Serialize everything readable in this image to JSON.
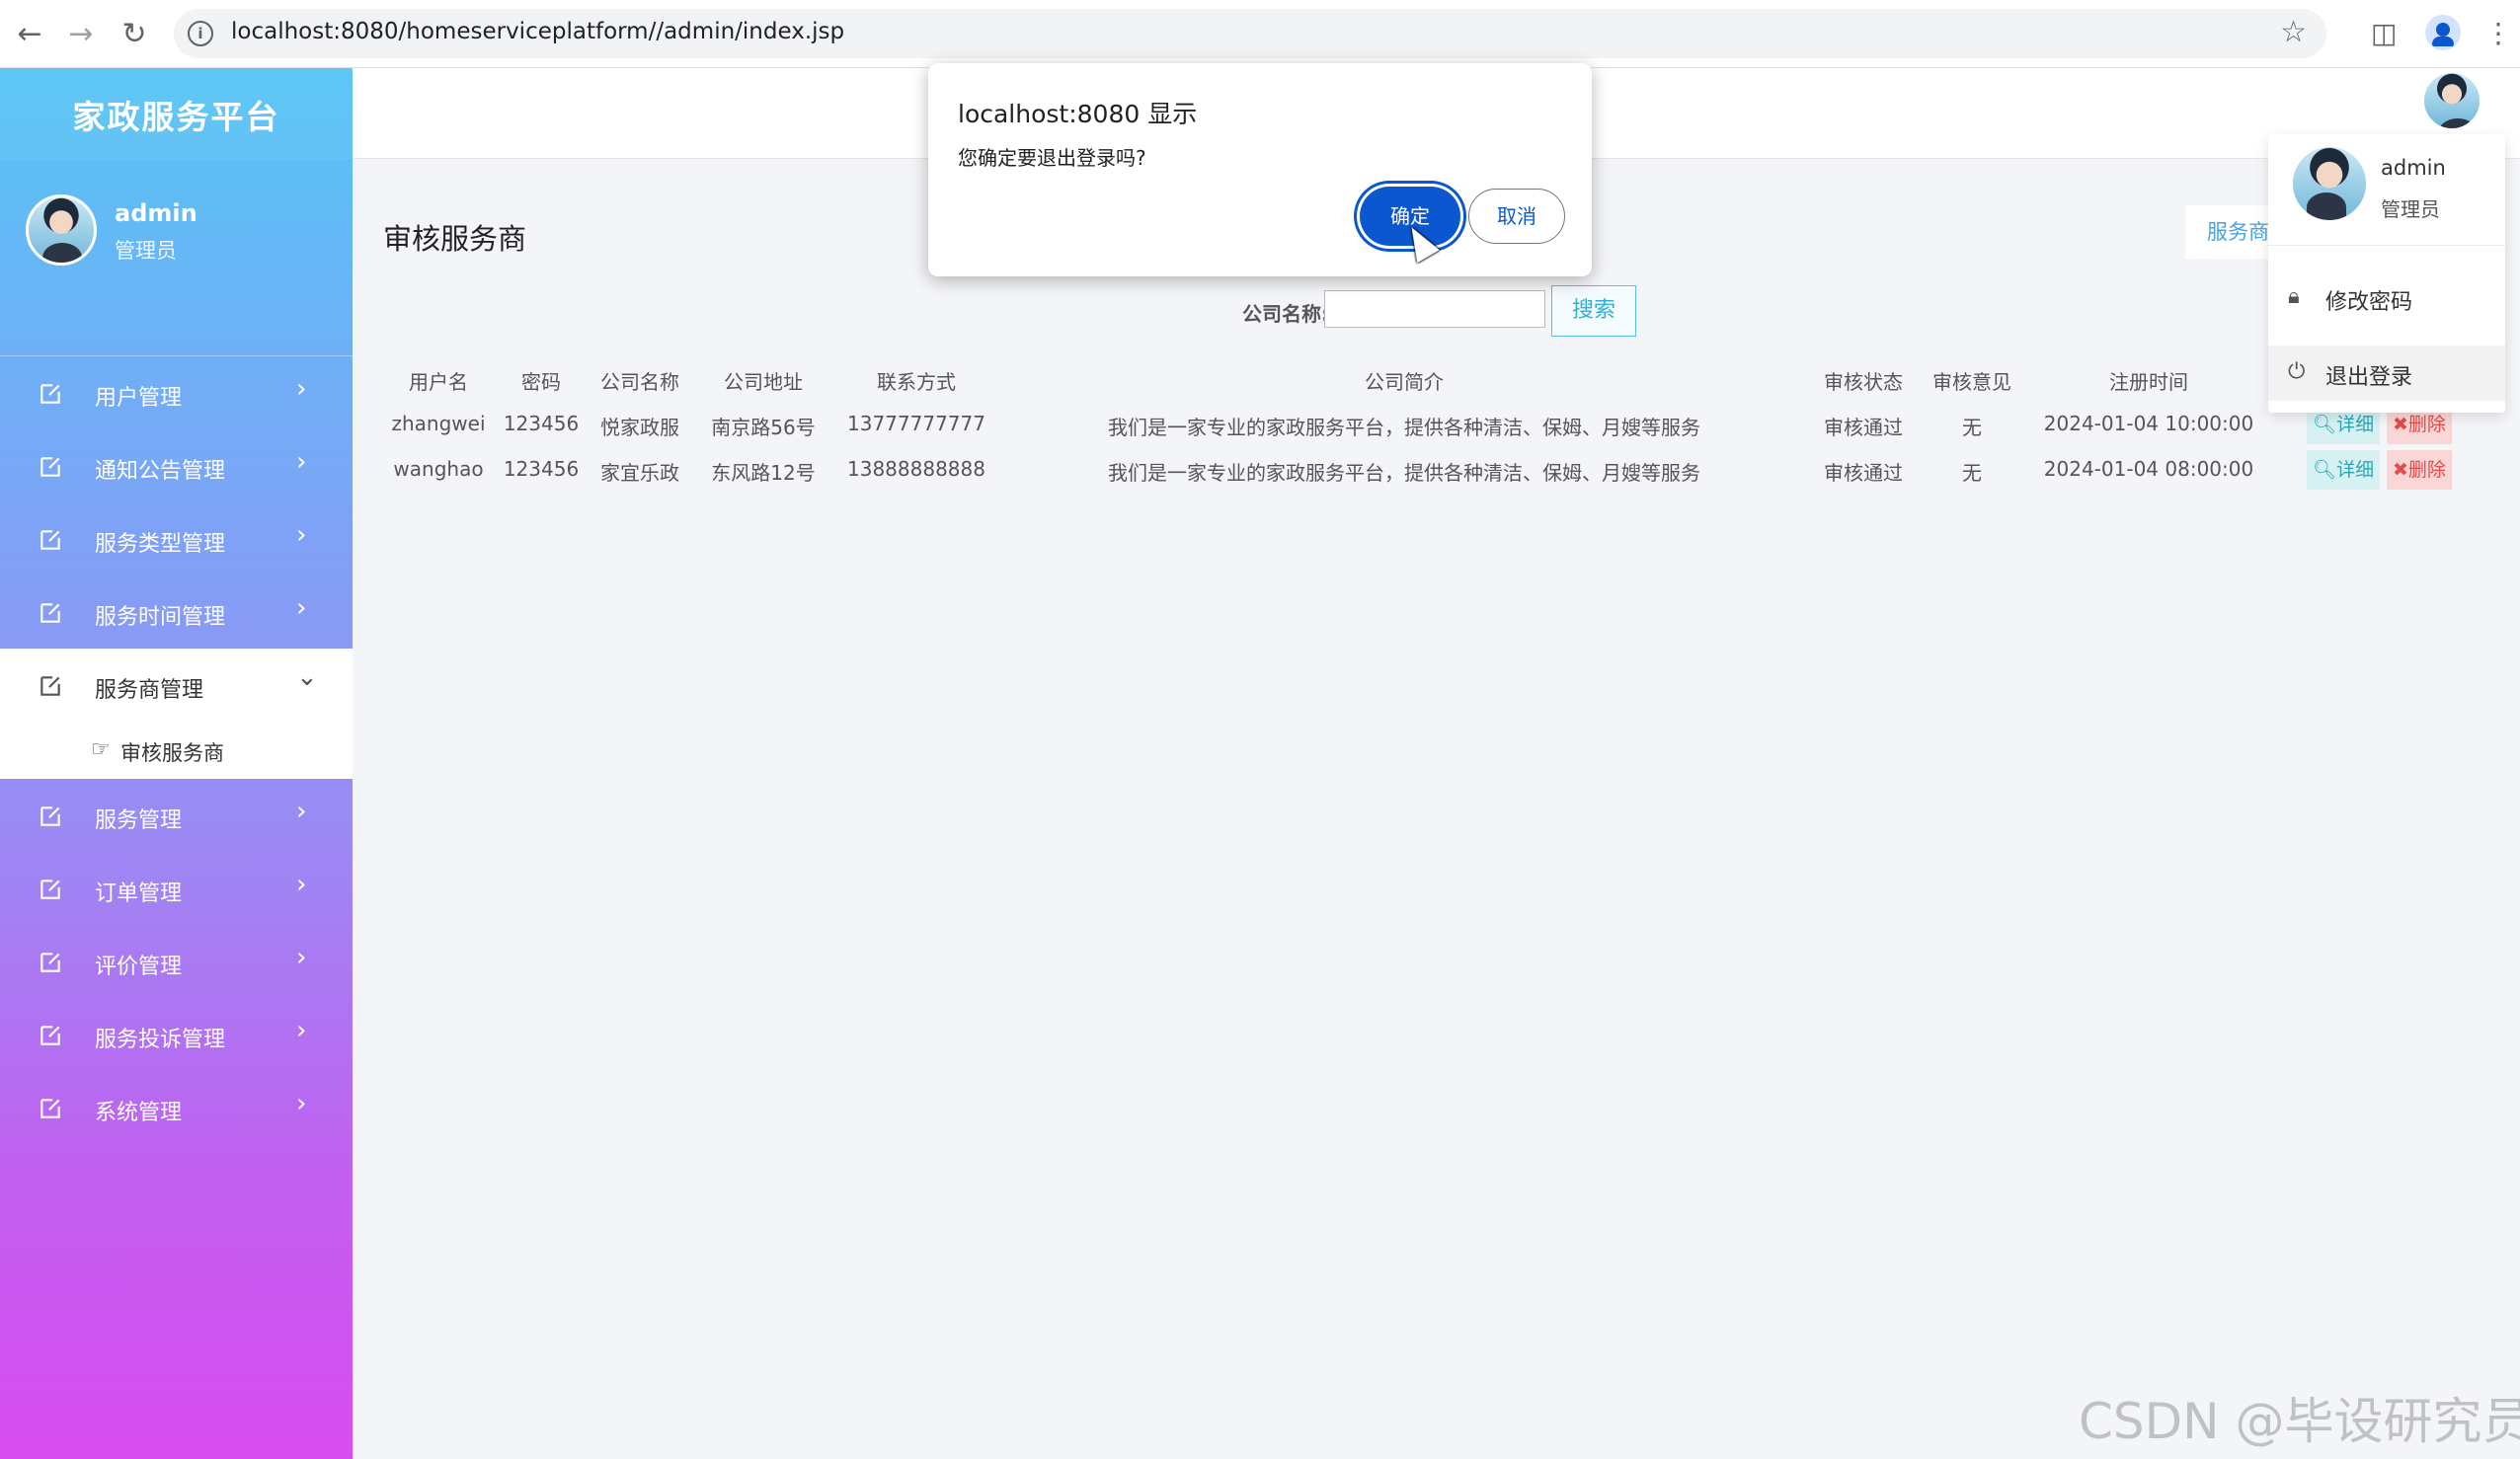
{
  "browser": {
    "url": "localhost:8080/homeserviceplatform//admin/index.jsp",
    "icons": [
      "back-icon",
      "forward-icon",
      "reload-icon",
      "info-icon",
      "bookmark-star-icon",
      "side-panel-icon",
      "profile-icon",
      "kebab-menu-icon"
    ]
  },
  "sidebar": {
    "brand": "家政服务平台",
    "user": {
      "name": "admin",
      "role": "管理员"
    },
    "items": [
      {
        "label": "用户管理"
      },
      {
        "label": "通知公告管理"
      },
      {
        "label": "服务类型管理"
      },
      {
        "label": "服务时间管理"
      },
      {
        "label": "服务商管理",
        "expanded": true,
        "children": [
          {
            "label": "审核服务商"
          }
        ]
      },
      {
        "label": "服务管理"
      },
      {
        "label": "订单管理"
      },
      {
        "label": "评价管理"
      },
      {
        "label": "服务投诉管理"
      },
      {
        "label": "系统管理"
      }
    ]
  },
  "main": {
    "title": "审核服务商",
    "provider_tag": "服务商",
    "search": {
      "label": "公司名称:",
      "value": "",
      "button": "搜索"
    },
    "table": {
      "headers": [
        "用户名",
        "密码",
        "公司名称",
        "公司地址",
        "联系方式",
        "公司简介",
        "审核状态",
        "审核意见",
        "注册时间"
      ],
      "rows": [
        [
          "zhangwei",
          "123456",
          "悦家政服",
          "南京路56号",
          "13777777777",
          "我们是一家专业的家政服务平台，提供各种清洁、保姆、月嫂等服务",
          "审核通过",
          "无",
          "2024-01-04 10:00:00"
        ],
        [
          "wanghao",
          "123456",
          "家宜乐政",
          "东风路12号",
          "13888888888",
          "我们是一家专业的家政服务平台，提供各种清洁、保姆、月嫂等服务",
          "审核通过",
          "无",
          "2024-01-04 08:00:00"
        ]
      ],
      "actions": {
        "detail": "详细",
        "delete": "删除"
      }
    }
  },
  "dropdown": {
    "name": "admin",
    "role": "管理员",
    "change_password": "修改密码",
    "logout": "退出登录"
  },
  "dialog": {
    "title": "localhost:8080 显示",
    "message": "您确定要退出登录吗?",
    "ok": "确定",
    "cancel": "取消"
  },
  "watermark": "CSDN @毕设研究员",
  "colors": {
    "primary_blue": "#0b57d0",
    "sidebar_top": "#55c5f5",
    "sidebar_bottom": "#d94df0",
    "detail": "#2aa7b8",
    "delete": "#e44a4a"
  }
}
